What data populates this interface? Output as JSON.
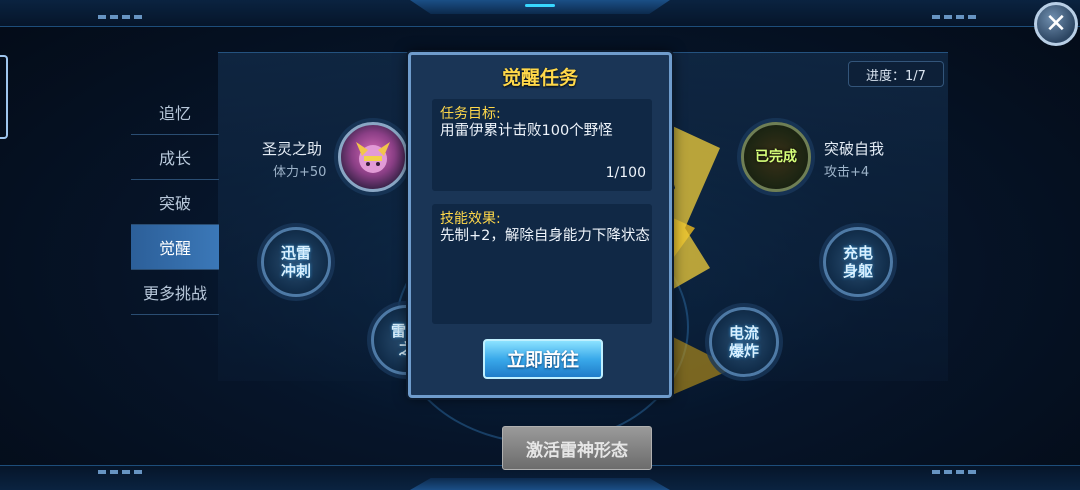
{
  "menu": {
    "items": [
      {
        "label": "追忆"
      },
      {
        "label": "成长"
      },
      {
        "label": "突破"
      },
      {
        "label": "觉醒"
      },
      {
        "label": "更多挑战"
      }
    ],
    "active_index": 3
  },
  "progress": {
    "text": "进度：1/7"
  },
  "nodes": {
    "top_left": {
      "title": "圣灵之助",
      "bonus": "体力+50"
    },
    "top_right": {
      "status": "已完成",
      "title": "突破自我",
      "bonus": "攻击+4"
    },
    "left": {
      "label": "迅雷冲刺"
    },
    "lower_left": {
      "label": "雷霆之"
    },
    "right": {
      "label": "充电身躯"
    },
    "lower_right": {
      "label": "电流爆炸"
    }
  },
  "modal": {
    "title": "觉醒任务",
    "objective_header": "任务目标:",
    "objective_text": "用雷伊累计击败100个野怪",
    "objective_count": "1/100",
    "effect_header": "技能效果:",
    "effect_text": "先制+2，解除自身能力下降状态",
    "go_button": "立即前往"
  },
  "activate_button": "激活雷神形态",
  "colors": {
    "accent_gold": "#ffd84a",
    "menu_active": "#3b78b8",
    "button_blue": "#3aa9ea"
  },
  "icons": {
    "close": "close-icon"
  }
}
